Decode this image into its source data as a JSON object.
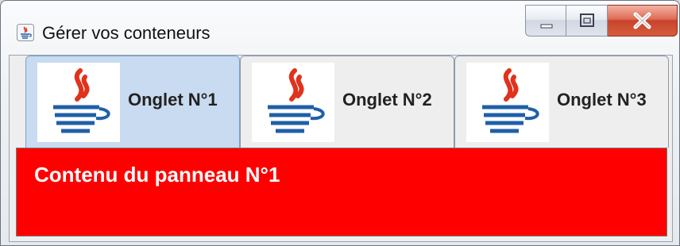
{
  "window": {
    "title": "Gérer vos conteneurs",
    "app_icon": "java-icon",
    "buttons": {
      "minimize": "minimize-icon",
      "maximize": "maximize-icon",
      "close": "close-icon"
    }
  },
  "tabs": [
    {
      "label": "Onglet N°1",
      "icon": "java-icon",
      "selected": true
    },
    {
      "label": "Onglet N°2",
      "icon": "java-icon",
      "selected": false
    },
    {
      "label": "Onglet N°3",
      "icon": "java-icon",
      "selected": false
    }
  ],
  "panel": {
    "text": "Contenu du panneau N°1",
    "background": "#ff0000"
  },
  "colors": {
    "selected_tab": "#c8dbf0",
    "close_button": "#c8432b"
  }
}
